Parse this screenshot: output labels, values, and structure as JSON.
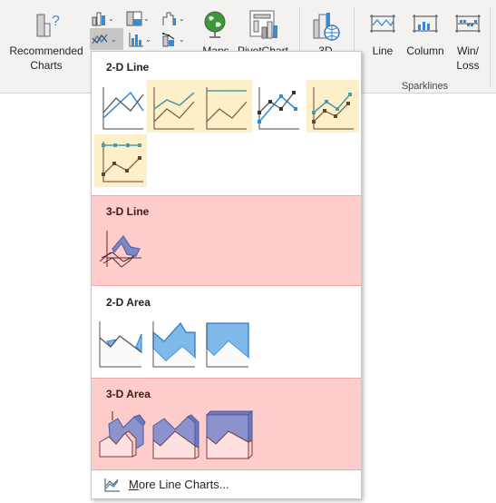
{
  "ribbon": {
    "recommended_charts": {
      "line1": "Recommended",
      "line2": "Charts"
    },
    "maps_label": "Maps",
    "pivotchart_label": "PivotChart",
    "threed_map_label": "3D",
    "sparklines": {
      "group_label": "Sparklines",
      "items": [
        {
          "label": "Line"
        },
        {
          "label": "Column"
        },
        {
          "label": "Win/",
          "label2": "Loss"
        }
      ]
    },
    "small_buttons": [
      {
        "icon": "column-chart-icon"
      },
      {
        "icon": "hierarchy-chart-icon"
      },
      {
        "icon": "waterfall-chart-icon"
      },
      {
        "icon": "line-chart-icon",
        "active": true
      },
      {
        "icon": "statistic-chart-icon"
      },
      {
        "icon": "combo-chart-icon"
      }
    ]
  },
  "dropdown": {
    "sections": [
      {
        "title": "2-D Line",
        "items": [
          {
            "name": "Line",
            "highlighted": false
          },
          {
            "name": "Stacked Line",
            "highlighted": true
          },
          {
            "name": "100% Stacked Line",
            "highlighted": true
          },
          {
            "name": "Line with Markers",
            "highlighted": false
          },
          {
            "name": "Stacked Line with Markers",
            "highlighted": true
          },
          {
            "name": "100% Stacked Line with Markers",
            "highlighted": true
          }
        ]
      },
      {
        "title": "3-D Line",
        "highlighted": true,
        "items": [
          {
            "name": "3-D Line"
          }
        ]
      },
      {
        "title": "2-D Area",
        "items": [
          {
            "name": "Area"
          },
          {
            "name": "Stacked Area"
          },
          {
            "name": "100% Stacked Area"
          }
        ]
      },
      {
        "title": "3-D Area",
        "highlighted": true,
        "items": [
          {
            "name": "3-D Area"
          },
          {
            "name": "3-D Stacked Area"
          },
          {
            "name": "3-D 100% Stacked Area"
          }
        ]
      }
    ],
    "more": {
      "mnemonic": "M",
      "rest": "ore Line Charts..."
    }
  },
  "colors": {
    "highlight": "#fdefc8",
    "pink": "#ffcccc",
    "blue": "#2e8ad8",
    "teal": "#4e9aa8",
    "brown": "#5c4a30",
    "area_fill": "#7fb9ea",
    "area3d_fill": "#8c93cc"
  }
}
